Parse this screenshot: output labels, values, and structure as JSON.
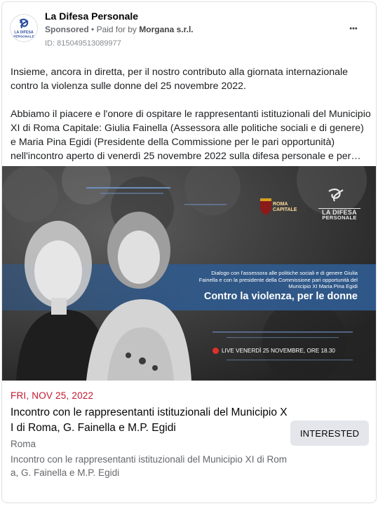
{
  "page": {
    "name": "La Difesa Personale",
    "avatar_text_line1": "LA DIFESA",
    "avatar_text_line2": "PERSONALE",
    "sponsored_label": "Sponsored",
    "separator": "•",
    "paid_for_prefix": "Paid for by",
    "paid_for_name": "Morgana s.r.l.",
    "ad_id": "ID: 815049513089977",
    "more_icon": "ellipsis-icon",
    "more_glyph": "•••"
  },
  "post": {
    "paragraph_1": "Insieme, ancora in diretta, per il nostro contributo alla giornata internazionale contro la violenza sulle donne del 25 novembre 2022.",
    "paragraph_2": "Abbiamo il piacere e l'onore di ospitare le rappresentanti istituzionali del Municipio XI di Roma Capitale: Giulia Fainella (Assessora alle politiche sociali e di genere) e Maria Pina Egidi (Presidente della Commissione per le pari opportunità) nell'incontro aperto di venerdì 25 novembre 2022 sulla difesa personale e per…"
  },
  "hero": {
    "roma_line1": "ROMA",
    "roma_line2": "CAPITALE",
    "logo_line1": "LA DIFESA",
    "logo_line2": "PERSONALE",
    "banner_subtitle": "Dialogo con l'assessora alle politiche sociali e di genere Giulia Fainella e con la presidente della Commissione pari opportunità del Municipio XI Maria Pina Egidi",
    "banner_title": "Contro la violenza, per le donne",
    "live_text": "LIVE VENERDÌ 25 NOVEMBRE, ORE 18.30",
    "colors": {
      "banner_blue": "#2f5a8e",
      "live_red": "#e0302a"
    }
  },
  "event": {
    "date": "FRI, NOV 25, 2022",
    "title": "Incontro con le rappresentanti istituzionali del Municipio XI di Roma, G. Fainella e M.P. Egidi",
    "location": "Roma",
    "description": "Incontro con le rappresentanti istituzionali del Municipio XI di Roma, G. Fainella e M.P. Egidi",
    "interested_label": "INTERESTED",
    "date_color": "#c3172e"
  }
}
